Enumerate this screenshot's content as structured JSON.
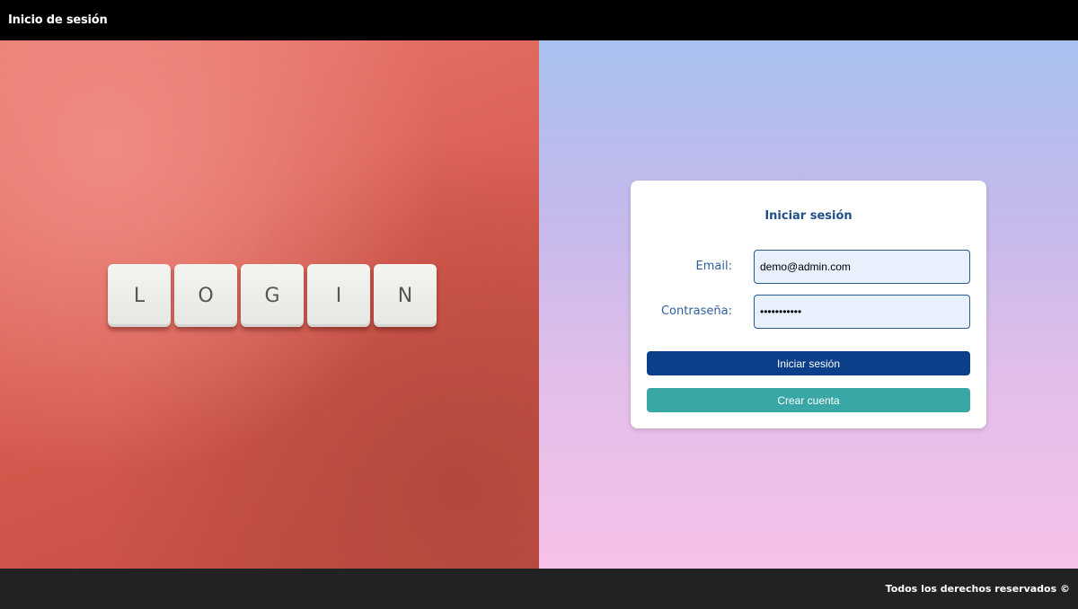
{
  "header": {
    "title": "Inicio de sesión"
  },
  "hero": {
    "keys": [
      "L",
      "O",
      "G",
      "I",
      "N"
    ]
  },
  "login_form": {
    "title": "Iniciar sesión",
    "email_label": "Email:",
    "email_value": "demo@admin.com",
    "password_label": "Contraseña:",
    "password_value": "demo@admin1",
    "login_button": "Iniciar sesión",
    "create_button": "Crear cuenta"
  },
  "footer": {
    "text": "Todos los derechos reservados ©"
  },
  "colors": {
    "primary_button": "#0b3f8a",
    "secondary_button": "#39a7a5",
    "label_text": "#2f5f9a"
  }
}
